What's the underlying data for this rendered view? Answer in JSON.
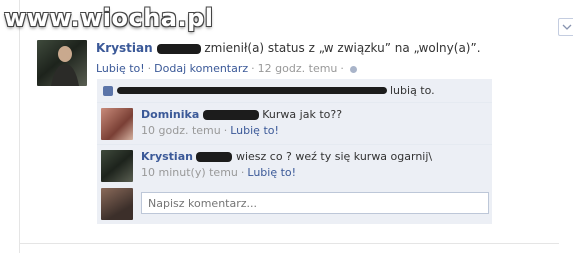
{
  "watermark": "www.wiocha.pl",
  "post": {
    "author": "Krystian",
    "status_text": "zmienił(a) status z „w związku” na „wolny(a)”.",
    "actions": {
      "like_label": "Lubię to!",
      "comment_label": "Dodaj komentarz",
      "timestamp": "12 godz. temu"
    }
  },
  "likes": {
    "text": "lubią to."
  },
  "comments": [
    {
      "author": "Dominika",
      "text": "Kurwa jak to??",
      "time": "10 godz. temu",
      "like_label": "Lubię to!"
    },
    {
      "author": "Krystian",
      "text": "wiesz co ? weź ty się kurwa ogarnij\\",
      "time": "10 minut(y) temu",
      "like_label": "Lubię to!"
    }
  ],
  "composer": {
    "placeholder": "Napisz komentarz..."
  },
  "colors": {
    "link": "#3b5998",
    "feedback_bg": "#eceff5"
  }
}
